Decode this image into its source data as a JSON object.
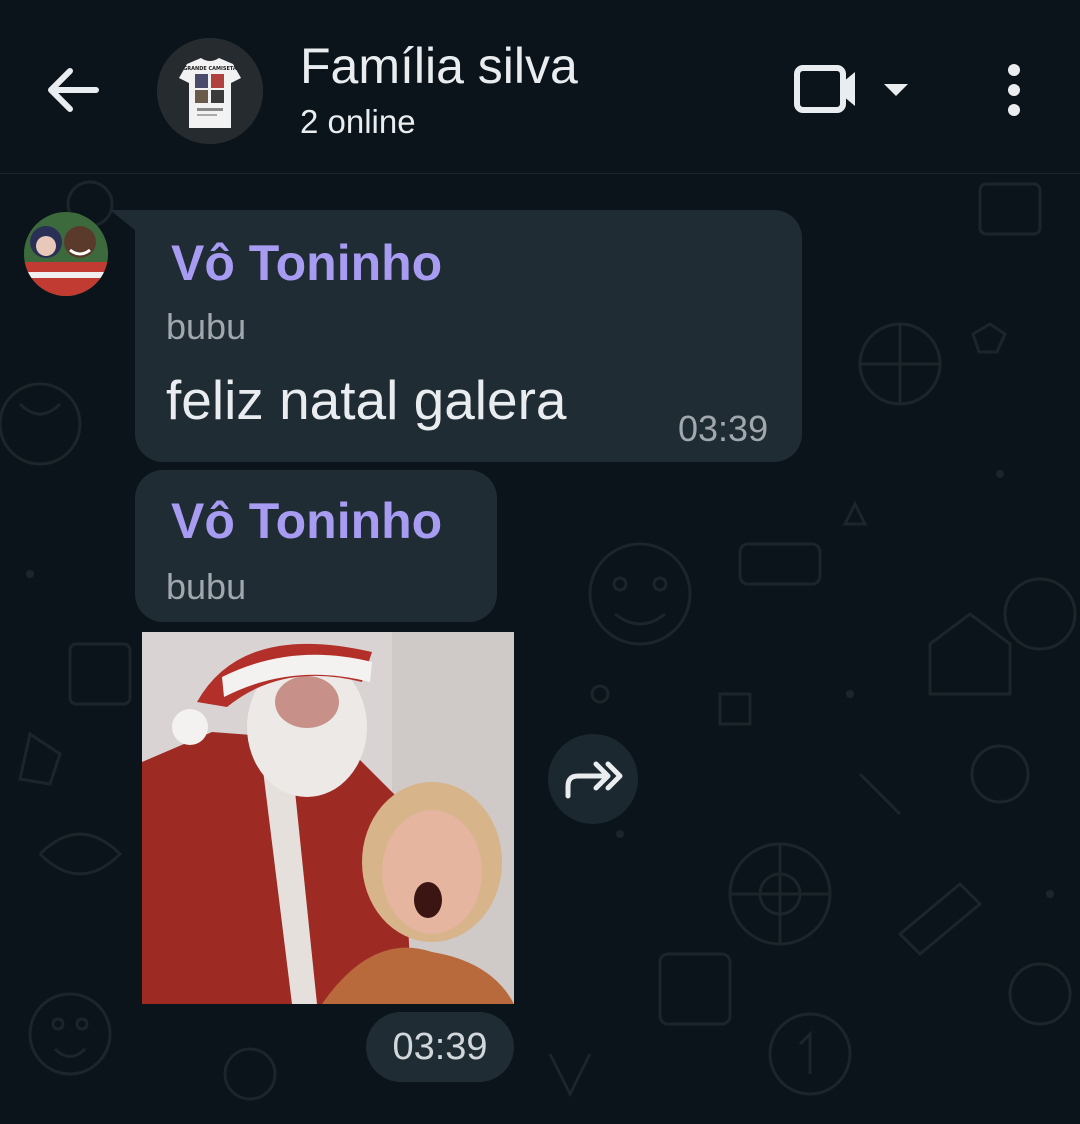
{
  "header": {
    "title": "Família silva",
    "subtitle": "2 online",
    "avatar_text": "GRANDE CAMISETA",
    "icons": [
      "back-arrow-icon",
      "video-call-icon",
      "dropdown-caret-icon",
      "more-vert-icon"
    ]
  },
  "messages": [
    {
      "sender": "Vô Toninho",
      "push_name": "bubu",
      "text": "feliz natal galera",
      "time": "03:39"
    },
    {
      "sender": "Vô Toninho",
      "push_name": "bubu",
      "media": "image",
      "time": "03:39"
    }
  ],
  "colors": {
    "background": "#0b141a",
    "bubble": "#1f2c34",
    "sender_name": "#a79cf2",
    "meta_text": "#a0a8ad",
    "text": "#e9edef"
  }
}
